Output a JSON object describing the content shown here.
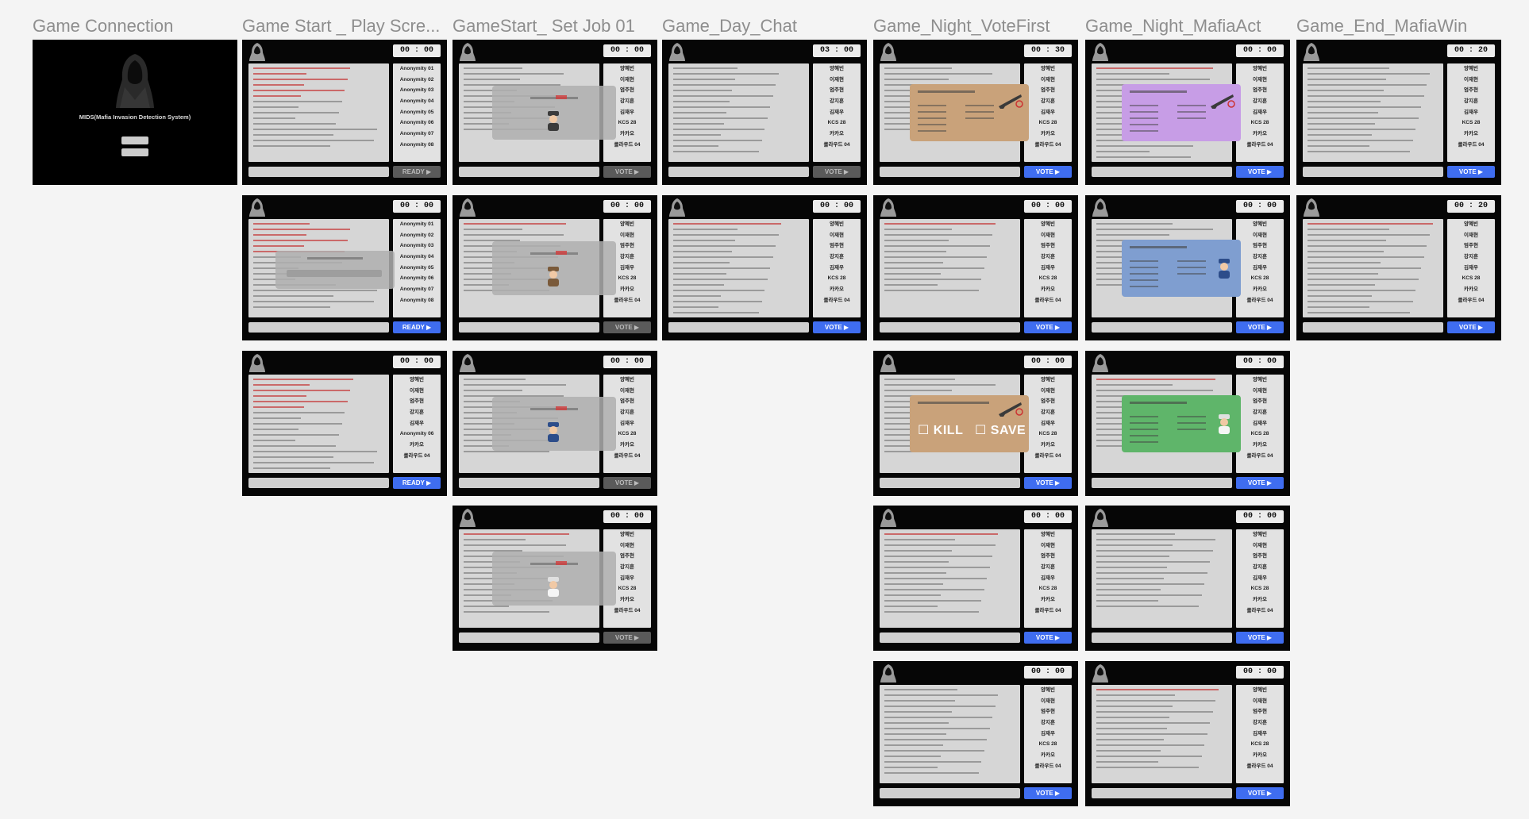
{
  "columns": [
    "Game Connection",
    "Game Start _ Play Scre...",
    "GameStart_ Set Job 01",
    "Game_Day_Chat",
    "Game_Night_VoteFirst",
    "Game_Night_MafiaAct",
    "Game_End_MafiaWin"
  ],
  "connection": {
    "system_title": "MIDS(Mafia Invasion Detection System)",
    "button_1": "",
    "button_2": ""
  },
  "players_anon": [
    "Anonymity 01",
    "Anonymity 02",
    "Anonymity 03",
    "Anonymity 04",
    "Anonymity 05",
    "Anonymity 06",
    "Anonymity 07",
    "Anonymity 08"
  ],
  "players_named": [
    "양혜빈",
    "이재현",
    "엄주현",
    "강지훈",
    "김재우",
    "KCS 28",
    "카카오",
    "클라우드 04"
  ],
  "players_ready": [
    "양혜빈",
    "이재현",
    "엄주현",
    "강지훈",
    "김재우",
    "Anonymity 06",
    "카카오",
    "클라우드 04"
  ],
  "timers": {
    "zero": "00 : 00",
    "day": "03 : 00",
    "vote": "00 : 30",
    "end": "00 : 20"
  },
  "buttons": {
    "ready": "READY",
    "vote": "VOTE"
  },
  "overlays": {
    "kill": "KILL",
    "save": "SAVE"
  },
  "colors": {
    "accent": "#3f6df0",
    "vote_first": "#c9a27a",
    "mafia_act": "#c79de6",
    "police_act": "#7f9ed0",
    "doctor_act": "#5fb56a",
    "frame": "#060606",
    "chat_bg": "#d6d6d6"
  }
}
